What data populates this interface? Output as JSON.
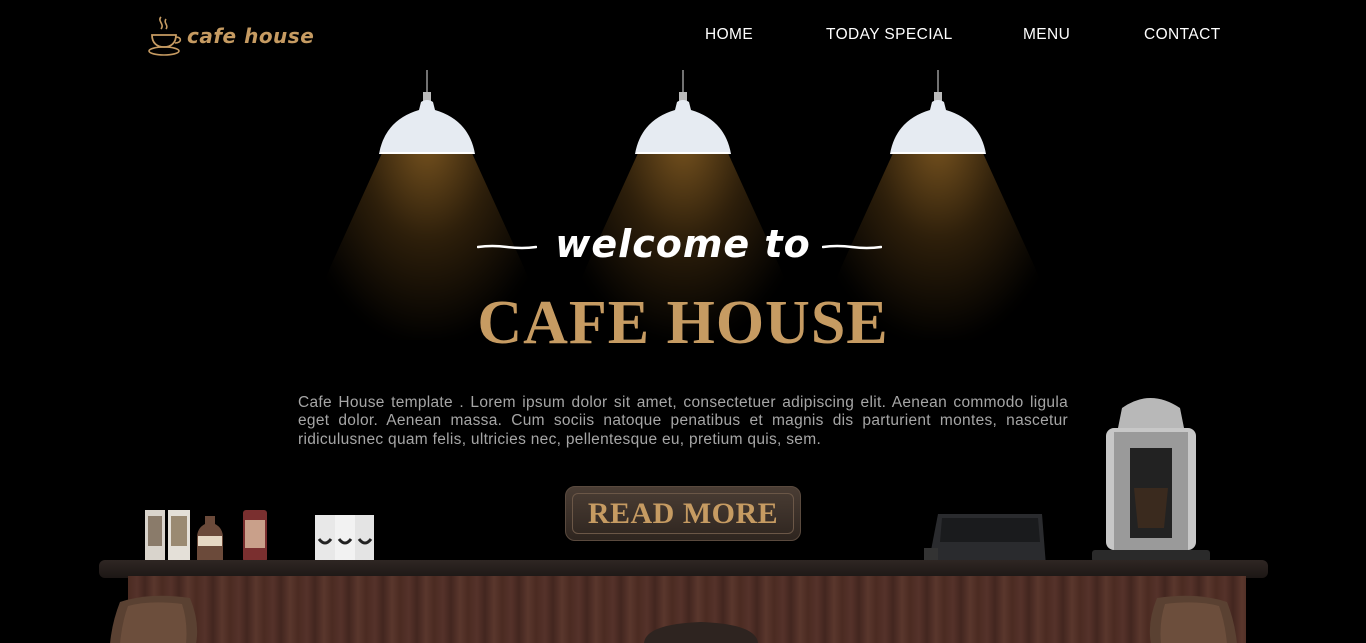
{
  "brand": {
    "logo_text": "cafe house",
    "logo_icon": "coffee-cup-icon",
    "accent_color": "#c69b62"
  },
  "nav": {
    "items": [
      {
        "label": "HOME"
      },
      {
        "label": "TODAY SPECIAL"
      },
      {
        "label": "MENU"
      },
      {
        "label": "CONTACT"
      }
    ]
  },
  "hero": {
    "welcome": "welcome to",
    "title": "CAFE HOUSE",
    "description": "Cafe House template . Lorem ipsum dolor sit amet, consectetuer adipiscing elit. Aenean commodo ligula eget dolor. Aenean massa. Cum sociis natoque penatibus et magnis dis parturient montes, nascetur ridiculusnec quam felis, ultricies nec, pellentesque eu, pretium quis, sem.",
    "button_label": "READ MORE"
  },
  "scene": {
    "lamps": [
      "pendant-lamp-icon",
      "pendant-lamp-icon",
      "pendant-lamp-icon"
    ],
    "counter_items": [
      "beverage-bottles",
      "coffee-bags",
      "cash-register",
      "espresso-machine"
    ]
  }
}
